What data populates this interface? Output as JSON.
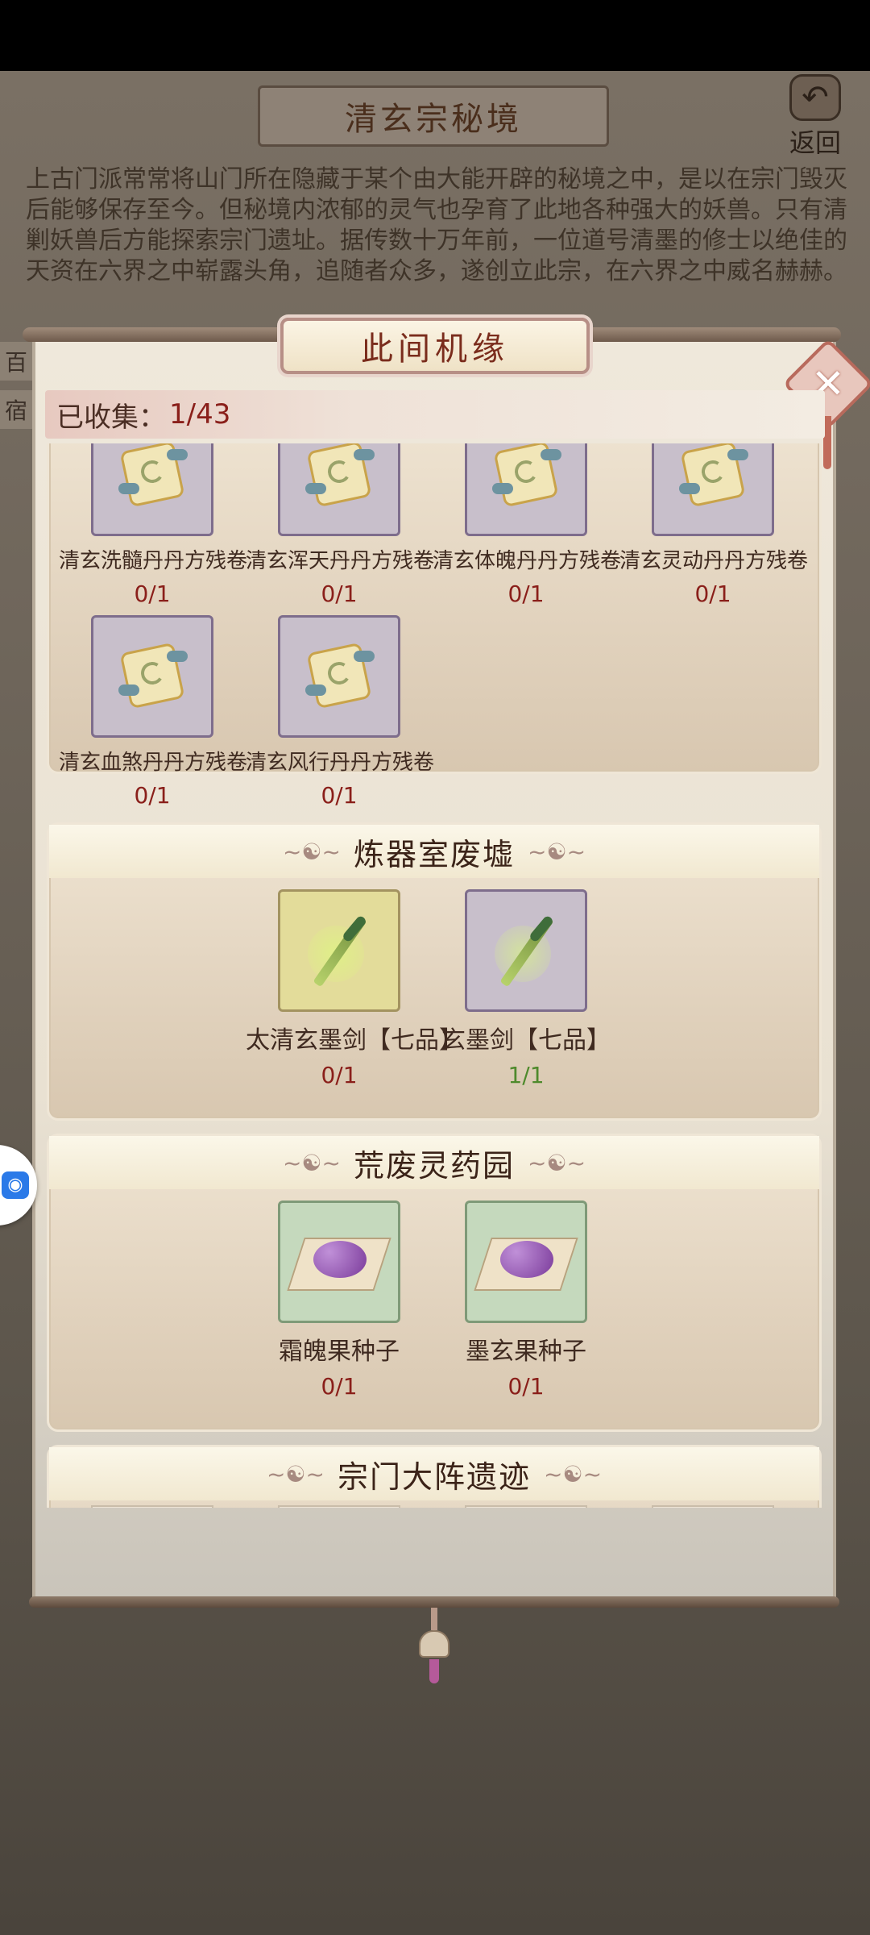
{
  "background": {
    "title": "清玄宗秘境",
    "back_label": "返回",
    "description": "上古门派常常将山门所在隐藏于某个由大能开辟的秘境之中，是以在宗门毁灭后能够保存至今。但秘境内浓郁的灵气也孕育了此地各种强大的妖兽。只有清剿妖兽后方能探索宗门遗址。据传数十万年前，一位道号清墨的修士以绝佳的天资在六界之中崭露头角，追随者众多，遂创立此宗，在六界之中威名赫赫。",
    "side_char_1": "百",
    "side_char_2": "宿"
  },
  "panel": {
    "title": "此间机缘",
    "collect_label": "已收集：",
    "collect_value": "1/43"
  },
  "sections": [
    {
      "items": [
        {
          "name": "清玄洗髓丹丹方残卷",
          "count": "0/1",
          "icon": "scroll-icon"
        },
        {
          "name": "清玄浑天丹丹方残卷",
          "count": "0/1",
          "icon": "scroll-icon"
        },
        {
          "name": "清玄体魄丹丹方残卷",
          "count": "0/1",
          "icon": "scroll-icon"
        },
        {
          "name": "清玄灵动丹丹方残卷",
          "count": "0/1",
          "icon": "scroll-icon"
        },
        {
          "name": "清玄血煞丹丹方残卷",
          "count": "0/1",
          "icon": "scroll-icon"
        },
        {
          "name": "清玄风行丹丹方残卷",
          "count": "0/1",
          "icon": "scroll-icon"
        }
      ]
    },
    {
      "title": "炼器室废墟",
      "items": [
        {
          "name": "太清玄墨剑【七品】",
          "count": "0/1",
          "icon": "sword-icon"
        },
        {
          "name": "玄墨剑【七品】",
          "count": "1/1",
          "icon": "sword-icon"
        }
      ]
    },
    {
      "title": "荒废灵药园",
      "items": [
        {
          "name": "霜魄果种子",
          "count": "0/1",
          "icon": "seed-icon"
        },
        {
          "name": "墨玄果种子",
          "count": "0/1",
          "icon": "seed-icon"
        }
      ]
    },
    {
      "title": "宗门大阵遗迹"
    }
  ],
  "icons": {
    "close": "close-icon",
    "back": "back-arrow-icon",
    "floating": "floating-tool-icon"
  },
  "colors": {
    "count_incomplete": "#8a1f1a",
    "count_complete": "#4e8a2c",
    "title_text": "#7a2c1c"
  }
}
